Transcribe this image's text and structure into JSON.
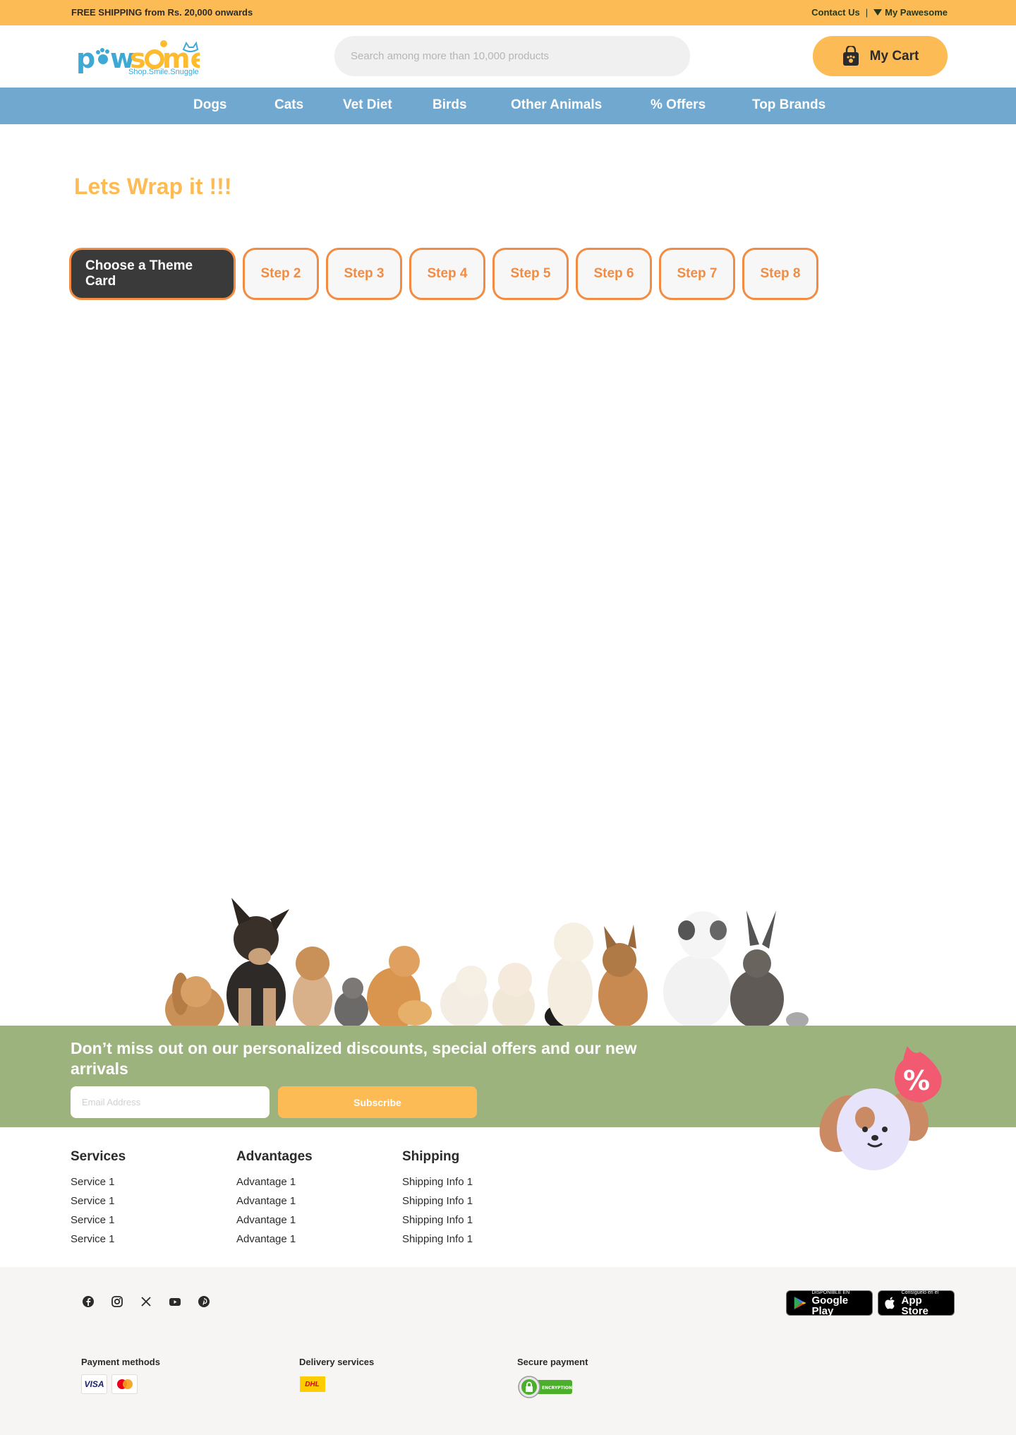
{
  "topbar": {
    "shipping_text": "FREE SHIPPING from Rs. 20,000 onwards",
    "contact_label": "Contact Us",
    "separator": "|",
    "account_label": "My Pawesome"
  },
  "header": {
    "logo_tagline": "Shop.Smile.Snuggle",
    "search_placeholder": "Search among more than 10,000 products",
    "cart_label": "My Cart"
  },
  "nav": {
    "items": [
      "Dogs",
      "Cats",
      "Vet Diet",
      "Birds",
      "Other Animals",
      "% Offers",
      "Top Brands"
    ]
  },
  "main": {
    "title": "Lets Wrap it !!!",
    "steps": [
      "Choose a Theme Card",
      "Step 2",
      "Step 3",
      "Step 4",
      "Step 5",
      "Step 6",
      "Step 7",
      "Step 8"
    ],
    "active_step": 0
  },
  "newsletter": {
    "message": "Don’t miss out on our personalized discounts, special offers and our new arrivals",
    "email_placeholder": "Email Address",
    "subscribe_label": "Subscribe"
  },
  "footer": {
    "columns": [
      {
        "title": "Services",
        "items": [
          "Service 1",
          "Service 1",
          "Service 1",
          "Service 1"
        ]
      },
      {
        "title": "Advantages",
        "items": [
          "Advantage 1",
          "Advantage 1",
          "Advantage 1",
          "Advantage 1"
        ]
      },
      {
        "title": "Shipping",
        "items": [
          "Shipping Info 1",
          "Shipping Info 1",
          "Shipping Info 1",
          "Shipping Info 1"
        ]
      }
    ],
    "social_icons": [
      "facebook-icon",
      "instagram-icon",
      "x-icon",
      "youtube-icon",
      "pinterest-icon"
    ],
    "stores": {
      "google_small": "DISPONIBLE EN",
      "google_big": "Google Play",
      "apple_small": "Consíguelo en el",
      "apple_big": "App Store"
    },
    "payment_label": "Payment methods",
    "payment_visa": "VISA",
    "delivery_label": "Delivery services",
    "delivery_dhl": "DHL",
    "secure_label": "Secure payment",
    "secure_badge": "ENCRYPTION"
  },
  "colors": {
    "topbar": "#fdbb55",
    "nav": "#71a8cf",
    "accent_orange": "#f28c43",
    "newsletter": "#9db37d",
    "footer_bg": "#f6f5f3"
  }
}
